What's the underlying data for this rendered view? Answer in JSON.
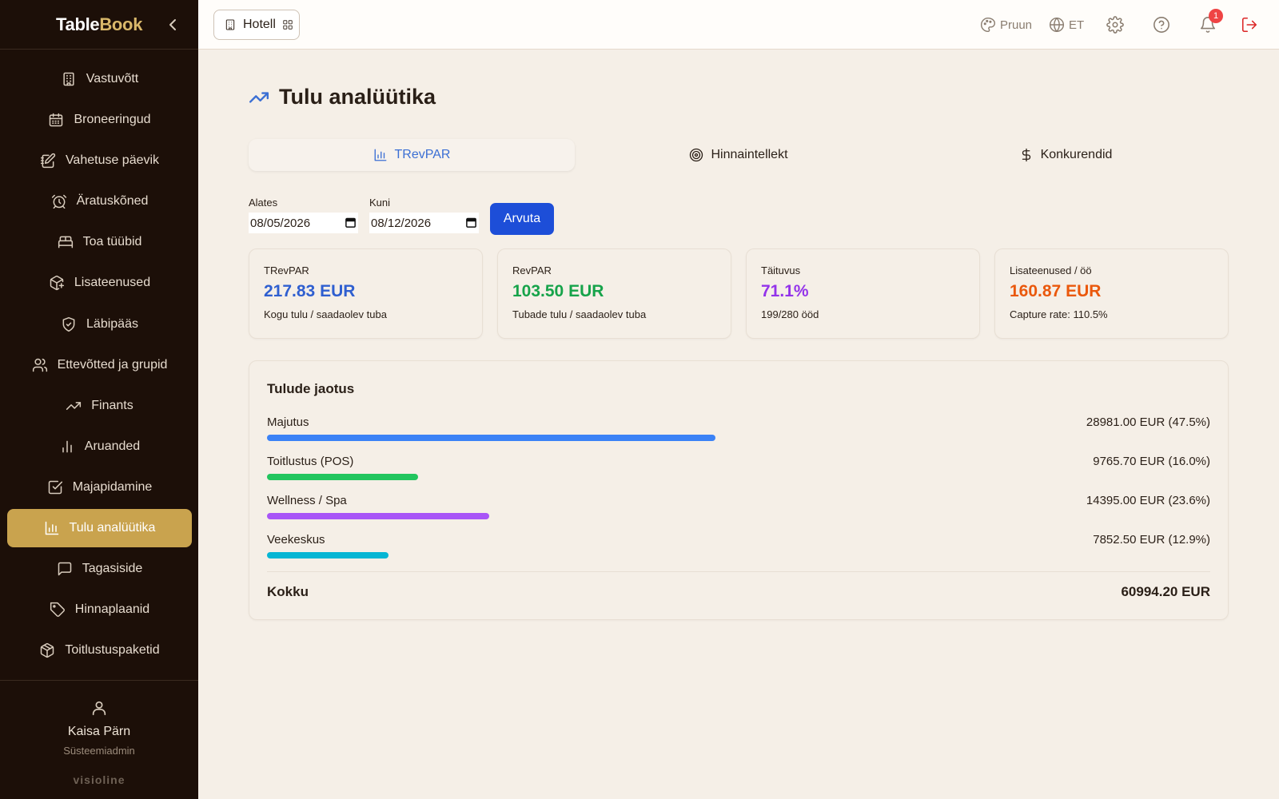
{
  "brand": {
    "part1": "Table",
    "part2": "Book"
  },
  "sidebar": {
    "items": [
      {
        "label": "Vastuvõtt",
        "icon": "building-icon"
      },
      {
        "label": "Broneeringud",
        "icon": "calendar-icon"
      },
      {
        "label": "Vahetuse päevik",
        "icon": "notebook-pen-icon"
      },
      {
        "label": "Äratuskõned",
        "icon": "alarm-clock-icon"
      },
      {
        "label": "Toa tüübid",
        "icon": "bed-icon"
      },
      {
        "label": "Lisateenused",
        "icon": "package-plus-icon"
      },
      {
        "label": "Läbipääs",
        "icon": "shield-check-icon"
      },
      {
        "label": "Ettevõtted ja grupid",
        "icon": "users-icon"
      },
      {
        "label": "Finants",
        "icon": "trending-up-icon"
      },
      {
        "label": "Aruanded",
        "icon": "bar-chart-icon"
      },
      {
        "label": "Majapidamine",
        "icon": "check-square-icon"
      },
      {
        "label": "Tulu analüütika",
        "icon": "chart-bars-icon",
        "active": true
      },
      {
        "label": "Tagasiside",
        "icon": "message-square-icon"
      },
      {
        "label": "Hinnaplaanid",
        "icon": "tag-icon"
      },
      {
        "label": "Toitlustuspaketid",
        "icon": "box-icon"
      }
    ],
    "user": {
      "name": "Kaisa Pärn",
      "role": "Süsteemiadmin"
    },
    "footer_brand": "visioline"
  },
  "topbar": {
    "hotel_label": "Hotell",
    "theme_label": "Pruun",
    "language_label": "ET",
    "notification_count": "1"
  },
  "page": {
    "title": "Tulu analüütika",
    "tabs": [
      {
        "label": "TRevPAR",
        "icon": "chart-bars-icon",
        "active": true
      },
      {
        "label": "Hinnaintellekt",
        "icon": "target-icon"
      },
      {
        "label": "Konkurendid",
        "icon": "dollar-icon"
      }
    ],
    "filters": {
      "from_label": "Alates",
      "from_value": "08/05/2026",
      "to_label": "Kuni",
      "to_value": "08/12/2026",
      "calculate_label": "Arvuta"
    },
    "kpis": [
      {
        "label": "TRevPAR",
        "value": "217.83 EUR",
        "sub": "Kogu tulu / saadaolev tuba",
        "color": "#2f5fd0"
      },
      {
        "label": "RevPAR",
        "value": "103.50 EUR",
        "sub": "Tubade tulu / saadaolev tuba",
        "color": "#16a34a"
      },
      {
        "label": "Täituvus",
        "value": "71.1%",
        "sub": "199/280 ööd",
        "color": "#9333ea"
      },
      {
        "label": "Lisateenused / öö",
        "value": "160.87 EUR",
        "sub": "Capture rate: 110.5%",
        "color": "#ea580c"
      }
    ],
    "breakdown": {
      "title": "Tulude jaotus",
      "rows": [
        {
          "name": "Majutus",
          "amount": "28981.00 EUR (47.5%)",
          "share": 47.5,
          "color": "#3b82f6"
        },
        {
          "name": "Toitlustus (POS)",
          "amount": "9765.70 EUR (16.0%)",
          "share": 16.0,
          "color": "#22c55e"
        },
        {
          "name": "Wellness / Spa",
          "amount": "14395.00 EUR (23.6%)",
          "share": 23.6,
          "color": "#a855f7"
        },
        {
          "name": "Veekeskus",
          "amount": "7852.50 EUR (12.9%)",
          "share": 12.9,
          "color": "#06b6d4"
        }
      ],
      "total_label": "Kokku",
      "total_value": "60994.20 EUR"
    }
  }
}
